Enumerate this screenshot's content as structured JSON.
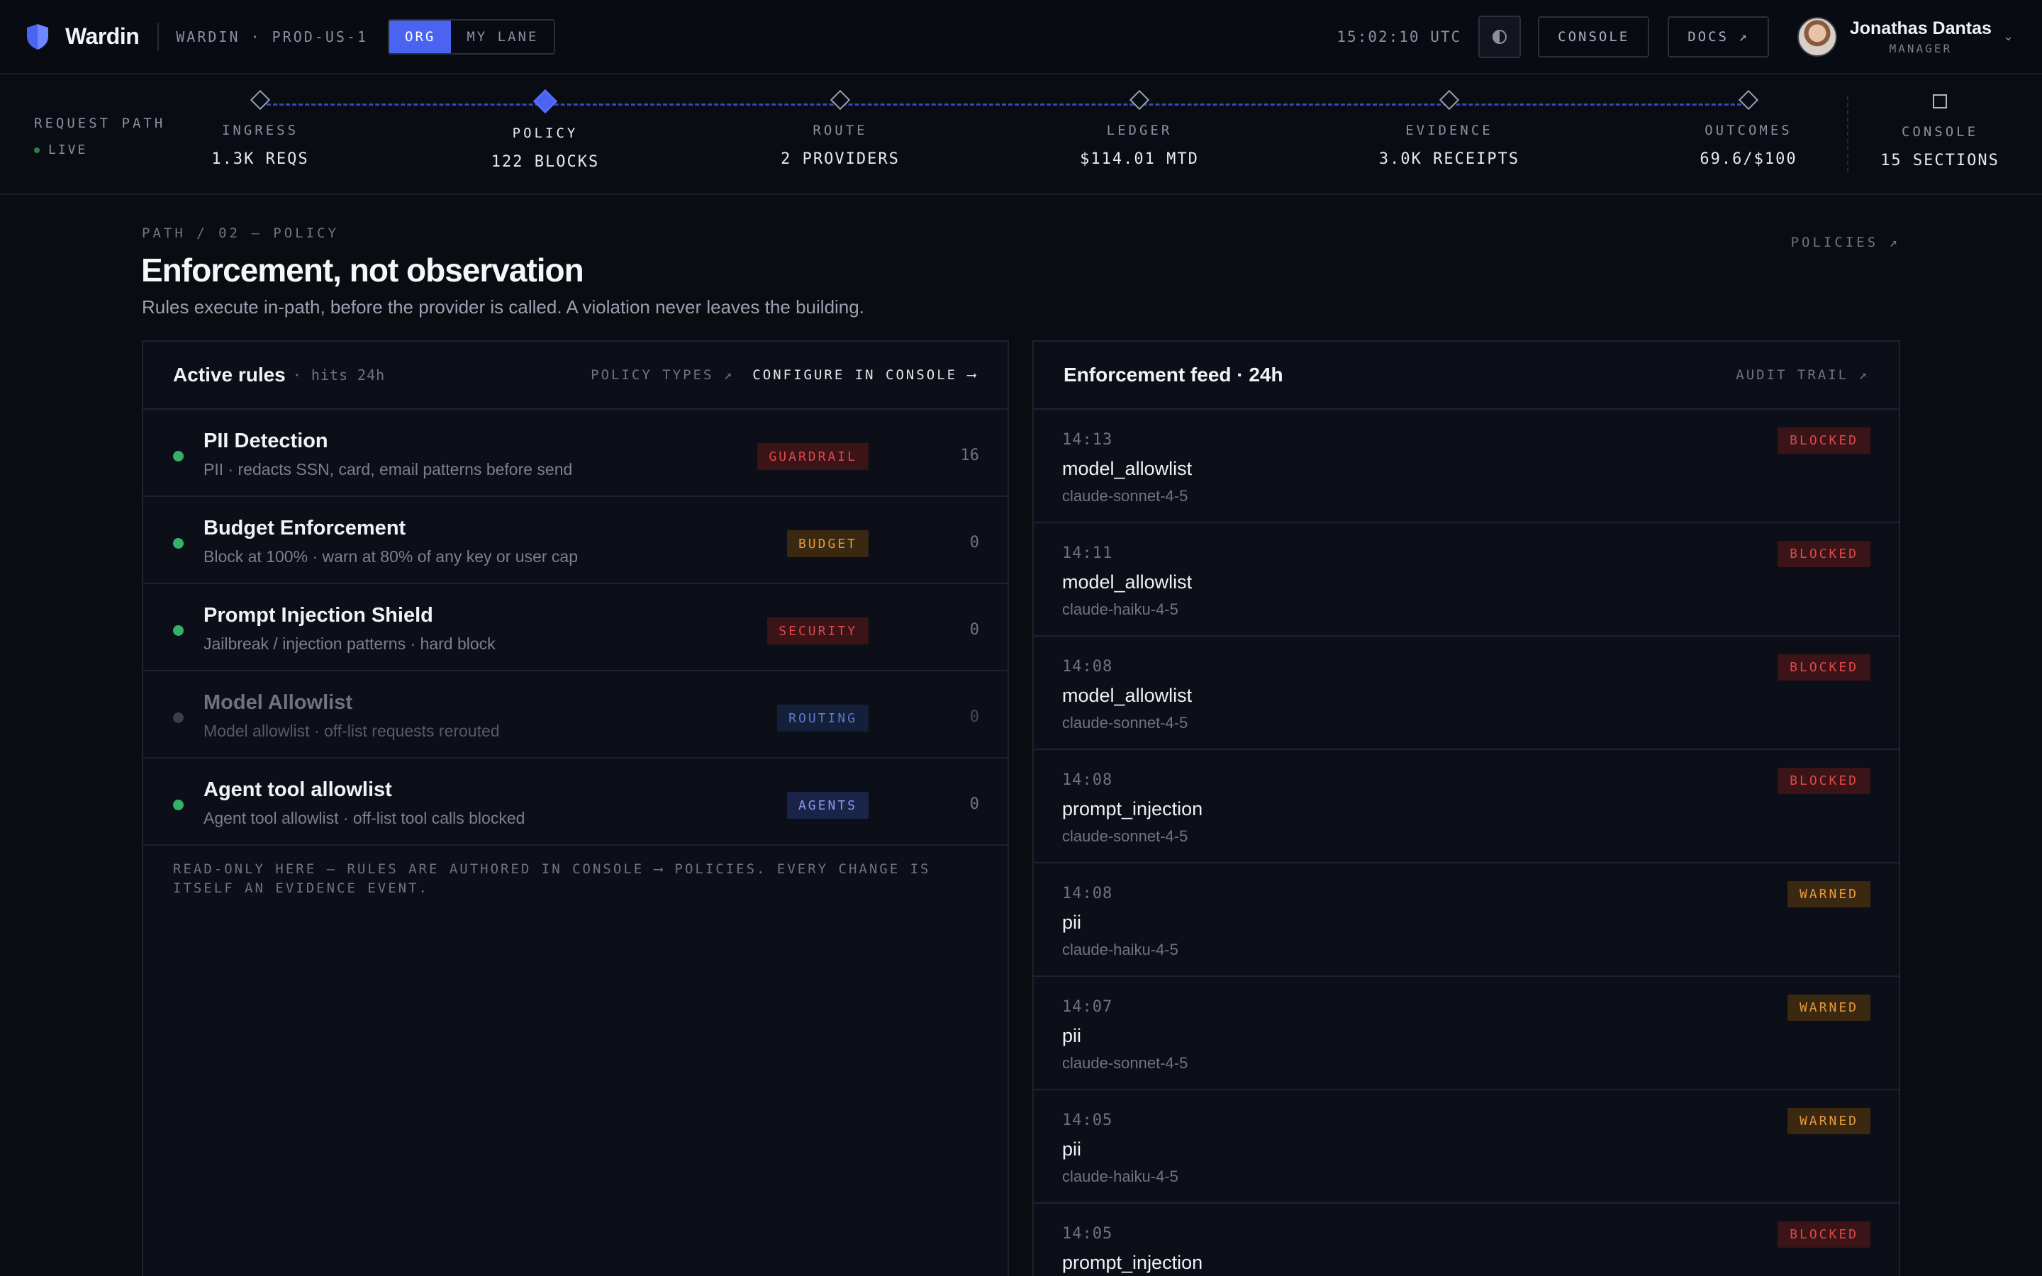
{
  "topbar": {
    "brand": "Wardin",
    "environment": "WARDIN · PROD-US-1",
    "scope_options": [
      "ORG",
      "MY LANE"
    ],
    "scope_active": "ORG",
    "clock": "15:02:10 UTC",
    "theme_icon": "half-circle-icon",
    "console_label": "CONSOLE",
    "docs_label": "DOCS ↗",
    "user": {
      "name": "Jonathas Dantas",
      "role": "MANAGER"
    }
  },
  "path": {
    "label": "REQUEST PATH",
    "live": "LIVE",
    "stages": [
      {
        "name": "INGRESS",
        "metric": "1.3K REQS",
        "active": false
      },
      {
        "name": "POLICY",
        "metric": "122 BLOCKS",
        "active": true
      },
      {
        "name": "ROUTE",
        "metric": "2 PROVIDERS",
        "active": false
      },
      {
        "name": "LEDGER",
        "metric": "$114.01 MTD",
        "active": false
      },
      {
        "name": "EVIDENCE",
        "metric": "3.0K RECEIPTS",
        "active": false
      },
      {
        "name": "OUTCOMES",
        "metric": "69.6/$100",
        "active": false
      },
      {
        "name": "CONSOLE",
        "metric": "15 SECTIONS",
        "active": false
      }
    ]
  },
  "page": {
    "breadcrumb": "PATH / 02 — POLICY",
    "policies_link": "POLICIES ↗",
    "title": "Enforcement, not observation",
    "subtitle": "Rules execute in-path, before the provider is called. A violation never leaves the building."
  },
  "rules_panel": {
    "title": "Active rules",
    "subtitle": "· hits 24h",
    "policy_types_link": "POLICY TYPES ↗",
    "configure_link": "CONFIGURE IN CONSOLE ⟶",
    "rules": [
      {
        "name": "PII Detection",
        "desc": "PII · redacts SSN, card, email patterns before send",
        "tag": "GUARDRAIL",
        "hits": "16",
        "enabled": true
      },
      {
        "name": "Budget Enforcement",
        "desc": "Block at 100% · warn at 80% of any key or user cap",
        "tag": "BUDGET",
        "hits": "0",
        "enabled": true
      },
      {
        "name": "Prompt Injection Shield",
        "desc": "Jailbreak / injection patterns · hard block",
        "tag": "SECURITY",
        "hits": "0",
        "enabled": true
      },
      {
        "name": "Model Allowlist",
        "desc": "Model allowlist · off-list requests rerouted",
        "tag": "ROUTING",
        "hits": "0",
        "enabled": false
      },
      {
        "name": "Agent tool allowlist",
        "desc": "Agent tool allowlist · off-list tool calls blocked",
        "tag": "AGENTS",
        "hits": "0",
        "enabled": true
      }
    ],
    "footnote": "READ-ONLY HERE — RULES ARE AUTHORED IN CONSOLE ⟶ POLICIES. EVERY CHANGE IS ITSELF AN EVIDENCE EVENT."
  },
  "feed_panel": {
    "title": "Enforcement feed · 24h",
    "audit_link": "AUDIT TRAIL ↗",
    "events": [
      {
        "time": "14:13",
        "policy": "model_allowlist",
        "model": "claude-sonnet-4-5",
        "status": "BLOCKED"
      },
      {
        "time": "14:11",
        "policy": "model_allowlist",
        "model": "claude-haiku-4-5",
        "status": "BLOCKED"
      },
      {
        "time": "14:08",
        "policy": "model_allowlist",
        "model": "claude-sonnet-4-5",
        "status": "BLOCKED"
      },
      {
        "time": "14:08",
        "policy": "prompt_injection",
        "model": "claude-sonnet-4-5",
        "status": "BLOCKED"
      },
      {
        "time": "14:08",
        "policy": "pii",
        "model": "claude-haiku-4-5",
        "status": "WARNED"
      },
      {
        "time": "14:07",
        "policy": "pii",
        "model": "claude-sonnet-4-5",
        "status": "WARNED"
      },
      {
        "time": "14:05",
        "policy": "pii",
        "model": "claude-haiku-4-5",
        "status": "WARNED"
      },
      {
        "time": "14:05",
        "policy": "prompt_injection",
        "model": "",
        "status": "BLOCKED"
      }
    ]
  },
  "colors": {
    "accent": "#4a63f0",
    "enabled_dot": "#35b26a",
    "blocked": "#e0484c",
    "warned": "#e89a3c"
  }
}
